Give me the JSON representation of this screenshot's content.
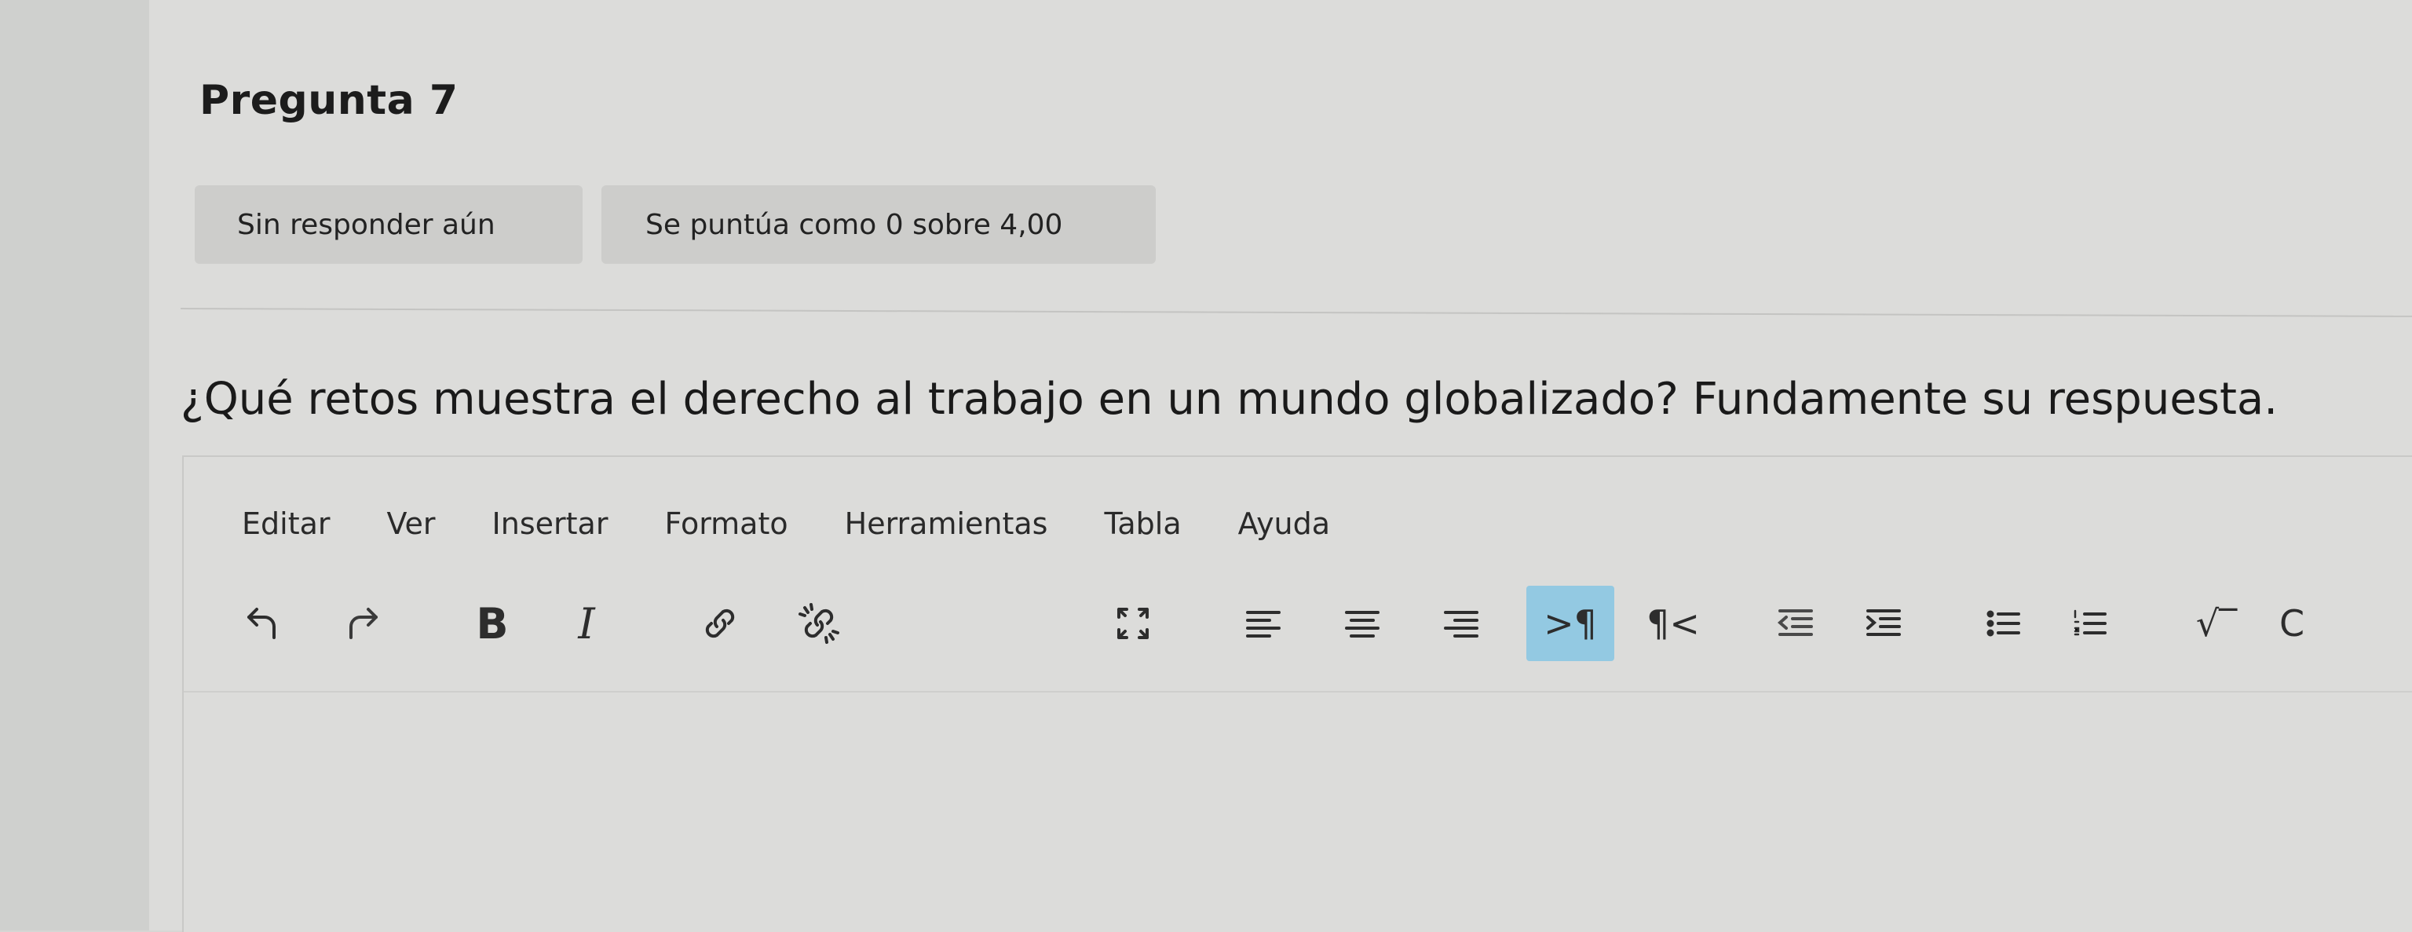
{
  "question": {
    "title": "Pregunta 7",
    "status": "Sin responder aún",
    "grade": "Se puntúa como 0 sobre 4,00",
    "text": "¿Qué retos muestra el derecho al trabajo en un mundo globalizado? Fundamente su respuesta."
  },
  "editor": {
    "menu": [
      "Editar",
      "Ver",
      "Insertar",
      "Formato",
      "Herramientas",
      "Tabla",
      "Ayuda"
    ],
    "toolbar": {
      "bold": "B",
      "italic": "I",
      "ltr": ">¶",
      "rtl": "¶<",
      "equation": "√‾",
      "chemistry": "C"
    }
  }
}
